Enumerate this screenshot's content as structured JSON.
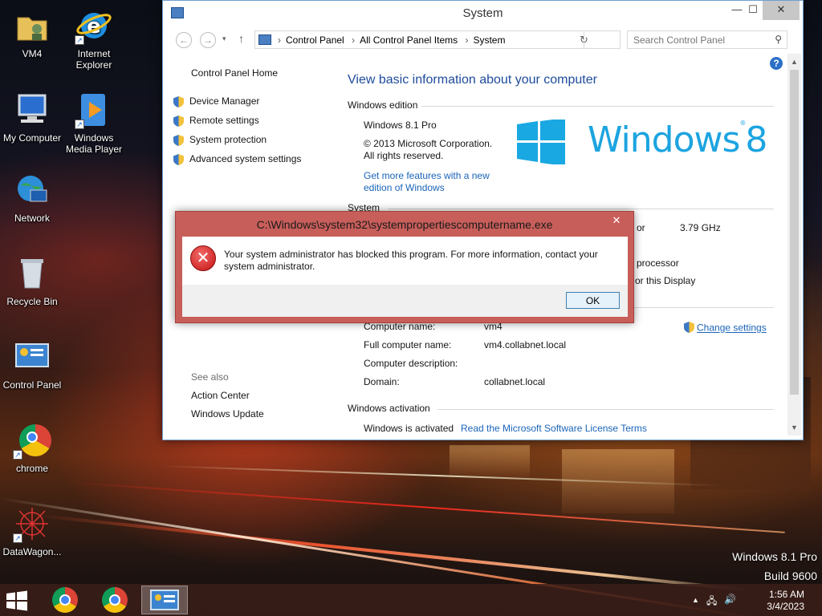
{
  "desktop": {
    "icons": [
      {
        "label": "VM4"
      },
      {
        "label": "Internet Explorer"
      },
      {
        "label": "My Computer"
      },
      {
        "label": "Windows Media Player"
      },
      {
        "label": "Network"
      },
      {
        "label": "Recycle Bin"
      },
      {
        "label": "Control Panel"
      },
      {
        "label": "chrome"
      },
      {
        "label": "DataWagon..."
      }
    ],
    "watermark": {
      "line1": "Windows 8.1 Pro",
      "line2": "Build 9600"
    }
  },
  "window": {
    "title": "System",
    "controls": {
      "minimize": "—",
      "maximize": "☐",
      "close": "✕"
    },
    "address": {
      "breadcrumbs": [
        "Control Panel",
        "All Control Panel Items",
        "System"
      ],
      "search_placeholder": "Search Control Panel"
    },
    "left_pane": {
      "home": "Control Panel Home",
      "links": [
        "Device Manager",
        "Remote settings",
        "System protection",
        "Advanced system settings"
      ],
      "see_also": "See also",
      "see_also_links": [
        "Action Center",
        "Windows Update"
      ]
    },
    "main": {
      "heading": "View basic information about your computer",
      "edition_header": "Windows edition",
      "edition": "Windows 8.1 Pro",
      "copyright_line1": "© 2013 Microsoft Corporation.",
      "copyright_line2": "All rights reserved.",
      "more_features_line1": "Get more features with a new",
      "more_features_line2": "edition of Windows",
      "logo_text": "Windows",
      "logo_number": "8",
      "system_header": "System",
      "processor_speed_fragment": "or",
      "processor_speed": "3.79 GHz",
      "system_type_fragment": "processor",
      "pen_touch_fragment": "or this Display",
      "computer_name_label": "Computer name:",
      "computer_name": "vm4",
      "full_name_label": "Full computer name:",
      "full_name": "vm4.collabnet.local",
      "description_label": "Computer description:",
      "domain_label": "Domain:",
      "domain": "collabnet.local",
      "change_settings": "Change settings",
      "activation_header": "Windows activation",
      "activation_status": "Windows is activated",
      "license_link": "Read the Microsoft Software License Terms"
    }
  },
  "dialog": {
    "title": "C:\\Windows\\system32\\systempropertiescomputername.exe",
    "close": "✕",
    "message": "Your system administrator has blocked this program. For more information, contact your system administrator.",
    "ok": "OK"
  },
  "taskbar": {
    "time": "1:56 AM",
    "date": "3/4/2023"
  }
}
